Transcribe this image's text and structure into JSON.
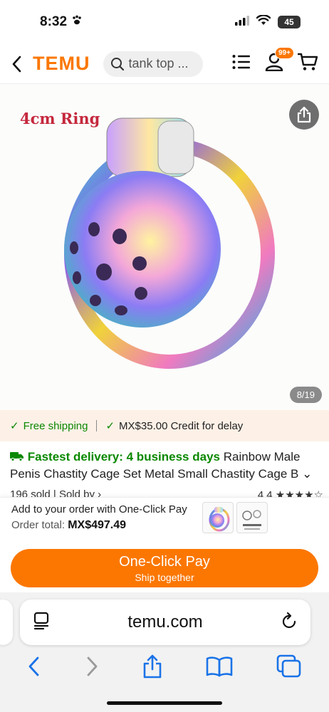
{
  "status_bar": {
    "time": "8:32",
    "battery": "45"
  },
  "header": {
    "logo": "TEMU",
    "search_placeholder": "tank top ...",
    "cart_badge": "99+"
  },
  "product": {
    "image_label": "4cm Ring",
    "image_counter": "8/19"
  },
  "shipping": {
    "free_shipping": "Free shipping",
    "credit": "MX$35.00 Credit for delay"
  },
  "listing": {
    "delivery": "Fastest delivery: 4 business days",
    "title_part1": "Rainbow Male",
    "title_part2": "Penis Chastity Cage Set Metal Small Chastity Cage B",
    "sold": "196 sold",
    "sold_by": "Sold by",
    "rating": "4.4"
  },
  "one_click": {
    "add_to_order": "Add to your order with One-Click Pay",
    "order_total_label": "Order total:",
    "order_total_value": "MX$497.49",
    "pay_label": "One-Click Pay",
    "pay_sub": "Ship together"
  },
  "browser": {
    "url": "temu.com"
  },
  "colors": {
    "brand_orange": "#fb7701",
    "green": "#0a8800",
    "label_red": "#c5283d"
  }
}
